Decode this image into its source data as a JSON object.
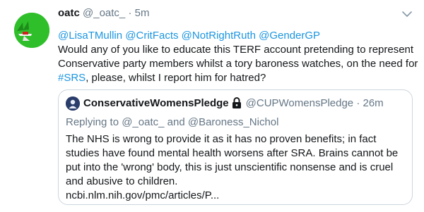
{
  "tweet": {
    "author_name": "oatc",
    "handle": "@_oatc_",
    "separator": "·",
    "time": "5m",
    "mentions": [
      "@LisaTMullin",
      "@CritFacts",
      "@NotRightRuth",
      "@GenderGP"
    ],
    "text_part1": "Would any of you like to educate this TERF account pretending to represent Conservative party members whilst a tory baroness watches, on the need for ",
    "hashtag": "#SRS",
    "text_part2": ", please, whilst I report him for hatred?",
    "menu_icon": "chevron-down-icon"
  },
  "quoted": {
    "author_name": "ConservativeWomensPledge",
    "lock_icon": "lock-icon",
    "handle": "@CUPWomensPledge",
    "separator": "·",
    "time": "26m",
    "replying_prefix": "Replying to",
    "replying_user1": "@_oatc_",
    "replying_and": "and",
    "replying_user2": "@Baroness_Nichol",
    "text": "The NHS is wrong to provide it as it has no proven benefits; in fact studies have found mental health worsens after SRA. Brains cannot be put into the 'wrong' body, this is just unscientific nonsense and is cruel and abusive to children.",
    "link": "ncbi.nlm.nih.gov/pmc/articles/P..."
  },
  "colors": {
    "link": "#1b95e0",
    "secondary": "#657786",
    "border": "#ccd6dd"
  }
}
